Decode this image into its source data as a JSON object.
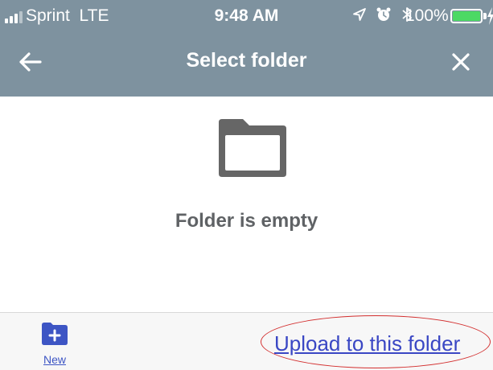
{
  "status_bar": {
    "carrier": "Sprint",
    "network": "LTE",
    "time": "9:48 AM",
    "battery_percent": "100%",
    "battery_level": 1.0,
    "icons": [
      "location-arrow-icon",
      "alarm-icon",
      "bluetooth-icon",
      "charging-bolt-icon"
    ]
  },
  "nav": {
    "title": "Select folder",
    "back_icon": "arrow-left-icon",
    "close_icon": "close-icon"
  },
  "empty_state": {
    "icon": "folder-icon",
    "message": "Folder is empty"
  },
  "bottom_bar": {
    "new_label": "New",
    "new_icon": "new-folder-plus-icon",
    "upload_label": "Upload to this folder"
  },
  "colors": {
    "header_background": "#7e929f",
    "link_blue": "#3a47c4",
    "folder_gray": "#666666",
    "annotation_red": "#d32f2f",
    "battery_green": "#4cd964"
  }
}
